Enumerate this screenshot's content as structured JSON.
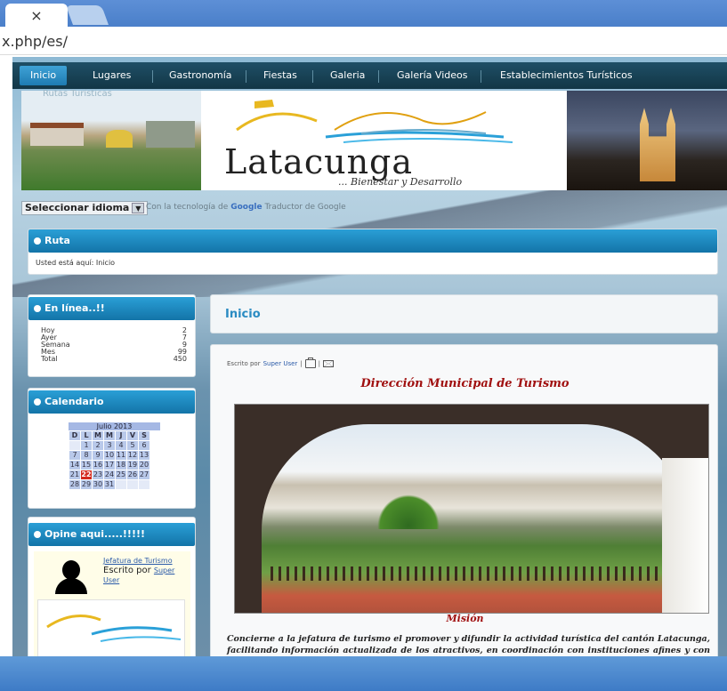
{
  "browser": {
    "tab_close": "×",
    "url": "x.php/es/"
  },
  "nav": {
    "items": [
      "Inicio",
      "Lugares",
      "Gastronomía",
      "Fiestas",
      "Galeria",
      "Galería Videos",
      "Establecimientos Turísticos"
    ],
    "sub_item": "Rutas Turísticas"
  },
  "header": {
    "logo_title": "Latacunga",
    "logo_subtitle": "... Bienestar y Desarrollo"
  },
  "language": {
    "select_label": "Seleccionar idioma",
    "select_arrow": "▼",
    "powered_prefix": "Con la tecnología de",
    "powered_google": "Google",
    "powered_suffix": "Traductor de Google"
  },
  "ruta": {
    "title": "Ruta",
    "text": "Usted está aquí: Inicio"
  },
  "online": {
    "title": "En línea..!!",
    "rows": [
      {
        "label": "Hoy",
        "value": "2"
      },
      {
        "label": "Ayer",
        "value": "7"
      },
      {
        "label": "Semana",
        "value": "9"
      },
      {
        "label": "Mes",
        "value": "99"
      },
      {
        "label": "Total",
        "value": "450"
      }
    ]
  },
  "calendar": {
    "title": "Calendario",
    "month": "Julio 2013",
    "days": [
      "D",
      "L",
      "M",
      "M",
      "J",
      "V",
      "S"
    ],
    "weeks": [
      [
        "",
        "1",
        "2",
        "3",
        "4",
        "5",
        "6"
      ],
      [
        "7",
        "8",
        "9",
        "10",
        "11",
        "12",
        "13"
      ],
      [
        "14",
        "15",
        "16",
        "17",
        "18",
        "19",
        "20"
      ],
      [
        "21",
        "22",
        "23",
        "24",
        "25",
        "26",
        "27"
      ],
      [
        "28",
        "29",
        "30",
        "31",
        "",
        "",
        ""
      ]
    ],
    "today": "22"
  },
  "opine": {
    "title": "Opine aqui.....!!!!!",
    "author_link": "Jefatura de Turismo",
    "written_by": "Escrito por",
    "user_link": "Super User"
  },
  "main": {
    "heading": "Inicio",
    "meta_prefix": "Escrito por",
    "meta_user": "Super User",
    "meta_separator": "|",
    "article_title": "Dirección Municipal de Turismo",
    "section_title": "Misión",
    "paragraph": "Concierne a la jefatura de turismo el promover y difundir la actividad turística del cantón Latacunga, facilitando información actualizada de los atractivos, en coordinación con instituciones afines y con la comunidad, generando planes, programas y proyectos orientados"
  }
}
